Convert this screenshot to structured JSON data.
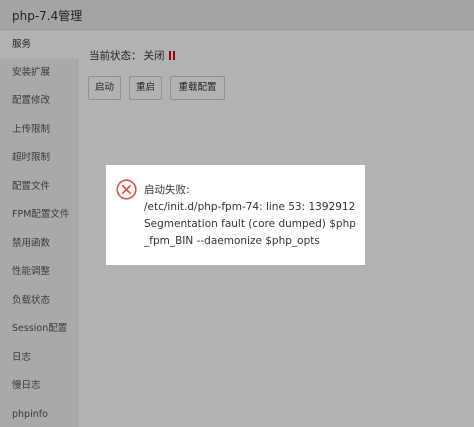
{
  "window": {
    "title": "php-7.4管理"
  },
  "sidebar": {
    "items": [
      {
        "label": "服务",
        "active": true
      },
      {
        "label": "安装扩展"
      },
      {
        "label": "配置修改"
      },
      {
        "label": "上传限制"
      },
      {
        "label": "超时限制"
      },
      {
        "label": "配置文件"
      },
      {
        "label": "FPM配置文件"
      },
      {
        "label": "禁用函数"
      },
      {
        "label": "性能调整"
      },
      {
        "label": "负载状态"
      },
      {
        "label": "Session配置"
      },
      {
        "label": "日志"
      },
      {
        "label": "慢日志"
      },
      {
        "label": "phpinfo"
      }
    ]
  },
  "main": {
    "status_label": "当前状态：",
    "status_value": "关闭",
    "status_color": "#d9001b",
    "buttons": {
      "start": "启动",
      "restart": "重启",
      "reload": "重载配置"
    }
  },
  "dialog": {
    "icon": "error-circle-x-icon",
    "icon_color": "#e05050",
    "title": "启动失败:",
    "message": "/etc/init.d/php-fpm-74: line 53: 1392912 Segmentation fault (core dumped) $php_fpm_BIN --daemonize $php_opts"
  }
}
